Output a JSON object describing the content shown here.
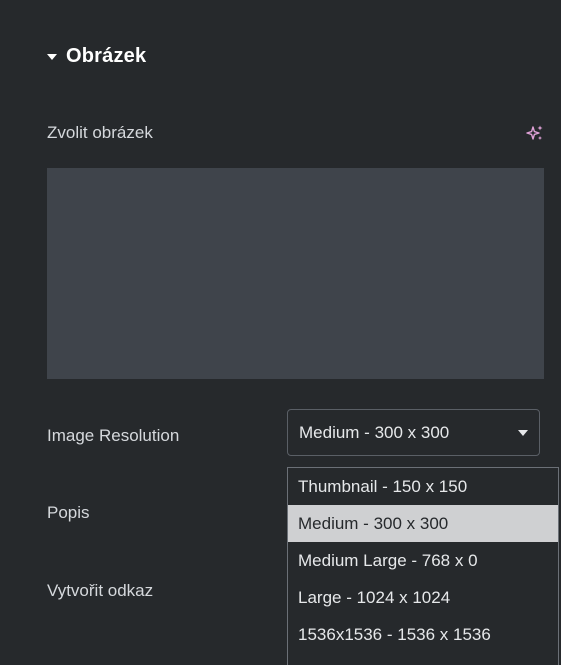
{
  "section": {
    "title": "Obrázek"
  },
  "image_field": {
    "label": "Zvolit obrázek"
  },
  "resolution": {
    "label": "Image Resolution",
    "selected": "Medium - 300 x 300",
    "options": [
      "Thumbnail - 150 x 150",
      "Medium - 300 x 300",
      "Medium Large - 768 x 0",
      "Large - 1024 x 1024",
      "1536x1536 - 1536 x 1536"
    ]
  },
  "caption": {
    "label": "Popis"
  },
  "link": {
    "label": "Vytvořit odkaz"
  },
  "icons": {
    "ai": "sparkle-ai-icon",
    "collapse": "caret-down-icon",
    "dropdown": "chevron-down-icon"
  },
  "colors": {
    "accent_ai": "#e0a2d8",
    "panel_bg": "#26292c",
    "image_placeholder": "#3f444b",
    "selected_option_bg": "#cfd0d2"
  }
}
